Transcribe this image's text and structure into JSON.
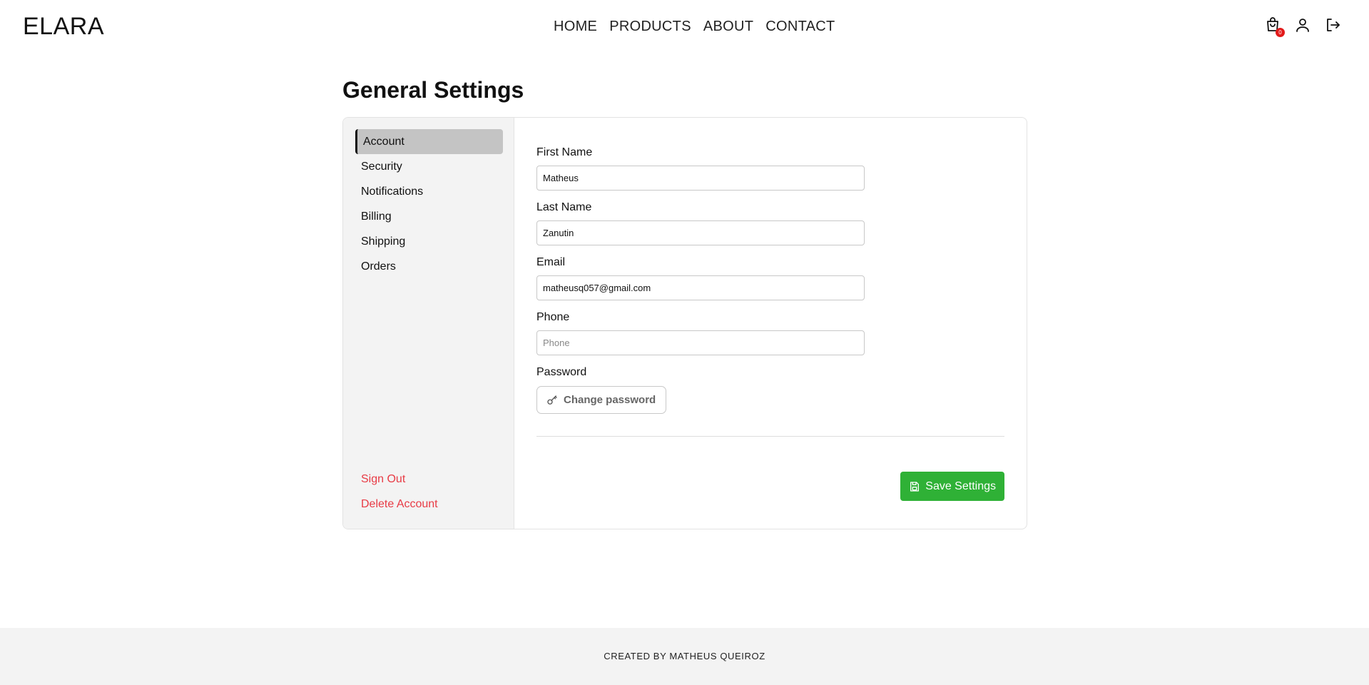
{
  "brand": {
    "logo": "ELARA"
  },
  "nav": {
    "items": [
      {
        "label": "HOME"
      },
      {
        "label": "PRODUCTS"
      },
      {
        "label": "ABOUT"
      },
      {
        "label": "CONTACT"
      }
    ]
  },
  "header_icons": {
    "cart_icon": "shopping-bag-icon",
    "cart_count": "0",
    "user_icon": "user-icon",
    "logout_icon": "logout-icon"
  },
  "page": {
    "title": "General Settings"
  },
  "sidebar": {
    "items": [
      {
        "label": "Account",
        "active": true
      },
      {
        "label": "Security"
      },
      {
        "label": "Notifications"
      },
      {
        "label": "Billing"
      },
      {
        "label": "Shipping"
      },
      {
        "label": "Orders"
      }
    ],
    "sign_out": "Sign Out",
    "delete_account": "Delete Account"
  },
  "form": {
    "first_name": {
      "label": "First Name",
      "value": "Matheus",
      "placeholder": "First Name"
    },
    "last_name": {
      "label": "Last Name",
      "value": "Zanutin",
      "placeholder": "Last Name"
    },
    "email": {
      "label": "Email",
      "value": "matheusq057@gmail.com",
      "placeholder": "Email"
    },
    "phone": {
      "label": "Phone",
      "value": "",
      "placeholder": "Phone"
    },
    "password": {
      "label": "Password",
      "button_label": "Change password",
      "icon": "key-icon"
    },
    "save_label": "Save Settings",
    "save_icon": "save-icon"
  },
  "footer": {
    "text": "CREATED BY MATHEUS QUEIROZ"
  },
  "colors": {
    "accent_green": "#2fb136",
    "danger_red": "#e83b45",
    "sidebar_bg": "#f3f3f3",
    "active_item_bg": "#c4c4c4",
    "badge_red": "#e21a1a"
  }
}
